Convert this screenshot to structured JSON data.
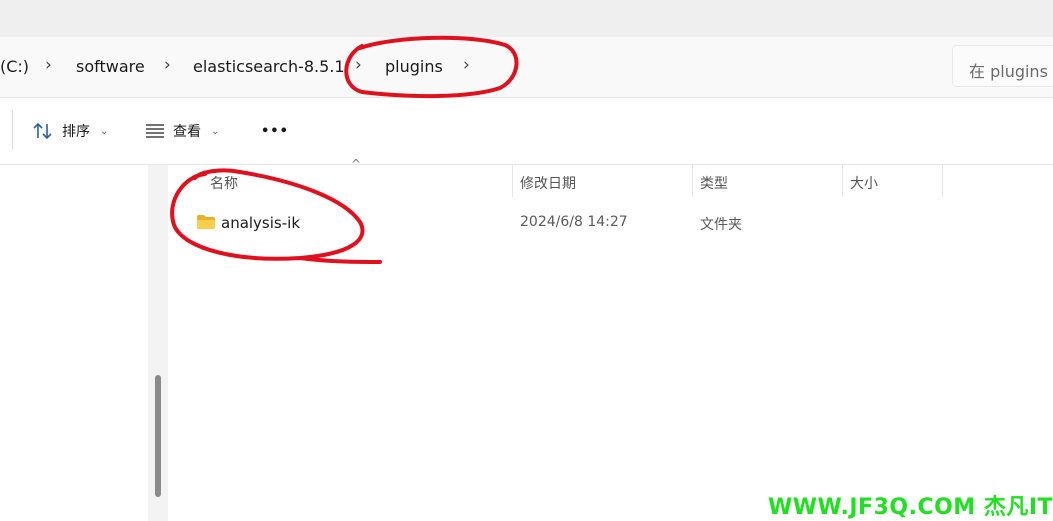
{
  "breadcrumb": {
    "items": [
      "(C:)",
      "software",
      "elasticsearch-8.5.1",
      "plugins"
    ],
    "separator": "›"
  },
  "search": {
    "placeholder": "在 plugins"
  },
  "toolbar": {
    "sort_label": "排序",
    "view_label": "查看",
    "more_label": "•••"
  },
  "file_list": {
    "columns": [
      "名称",
      "修改日期",
      "类型",
      "大小"
    ],
    "rows": [
      {
        "name": "analysis-ik",
        "modified": "2024/6/8 14:27",
        "type": "文件夹",
        "size": ""
      }
    ]
  },
  "watermark": "WWW.JF3Q.COM 杰凡IT",
  "colors": {
    "annotation_red": "#e0101c",
    "watermark_green": "#21e021",
    "folder_yellow": "#f3c537"
  }
}
